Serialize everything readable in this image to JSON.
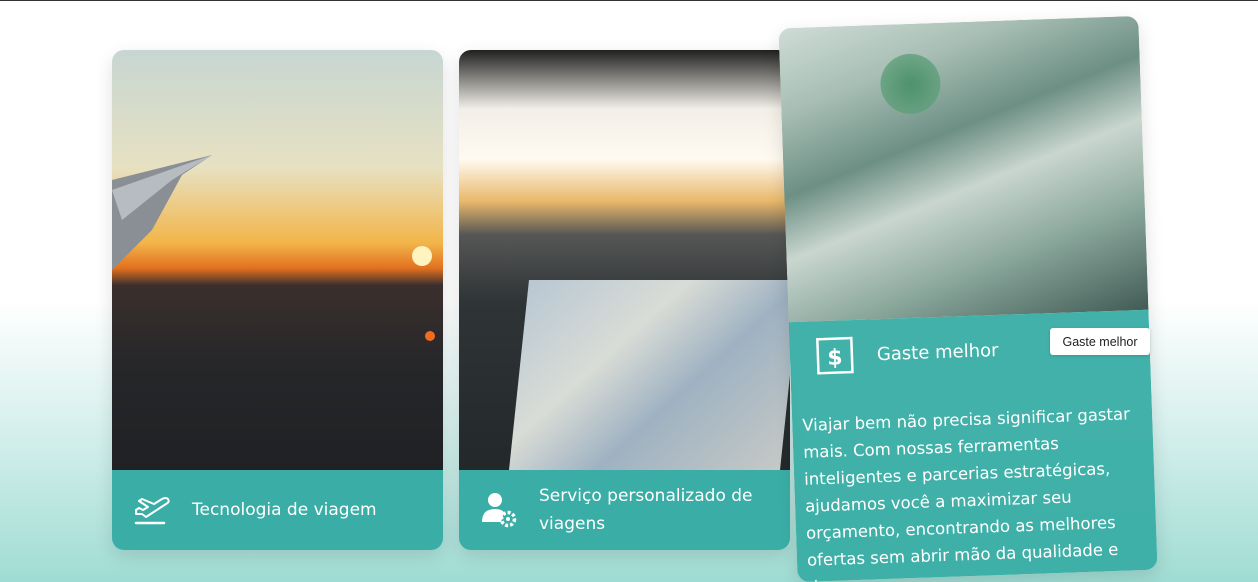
{
  "cards": [
    {
      "title": "Tecnologia de viagem",
      "icon": "plane-takeoff-icon",
      "photo": "airplane-wing-sunset"
    },
    {
      "title": "Serviço personalizado de viagens",
      "icon": "user-gear-icon",
      "photo": "car-dashboard-map"
    },
    {
      "title": "Gaste melhor",
      "icon": "dollar-sign-icon",
      "photo": "dollar-bills",
      "description": "Viajar bem não precisa significar gastar mais. Com nossas ferramentas inteligentes e parcerias estratégicas, ajudamos você a maximizar seu orçamento, encontrando as melhores ofertas sem abrir mão da qualidade e do"
    }
  ],
  "tooltip": "Gaste melhor",
  "colors": {
    "accent": "#3aaea6",
    "background_bottom": "#9fdcd3"
  }
}
